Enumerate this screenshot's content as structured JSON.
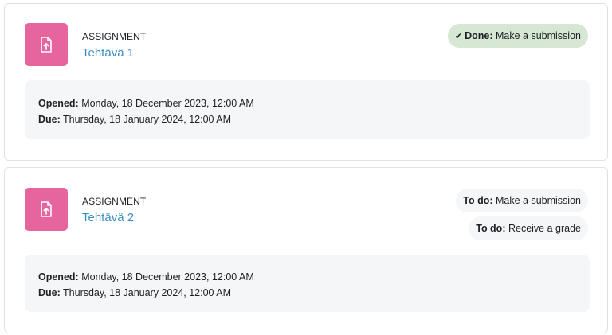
{
  "activities": [
    {
      "type_label": "ASSIGNMENT",
      "title": "Tehtävä 1",
      "icon": "assignment-upload-icon",
      "icon_color": "#e7659f",
      "completion": [
        {
          "status": "Done:",
          "label": "Make a submission",
          "state": "done",
          "color": "#d6e7d3"
        }
      ],
      "dates": {
        "opened_label": "Opened:",
        "opened_value": "Monday, 18 December 2023, 12:00 AM",
        "due_label": "Due:",
        "due_value": "Thursday, 18 January 2024, 12:00 AM"
      }
    },
    {
      "type_label": "ASSIGNMENT",
      "title": "Tehtävä 2",
      "icon": "assignment-upload-icon",
      "icon_color": "#e7659f",
      "completion": [
        {
          "status": "To do:",
          "label": "Make a submission",
          "state": "todo"
        },
        {
          "status": "To do:",
          "label": "Receive a grade",
          "state": "todo"
        }
      ],
      "dates": {
        "opened_label": "Opened:",
        "opened_value": "Monday, 18 December 2023, 12:00 AM",
        "due_label": "Due:",
        "due_value": "Thursday, 18 January 2024, 12:00 AM"
      }
    }
  ],
  "colors": {
    "link": "#3b8fc0",
    "done_badge": "#d6e7d3",
    "todo_badge": "#f5f6f8",
    "dates_panel": "#f5f6f8"
  }
}
